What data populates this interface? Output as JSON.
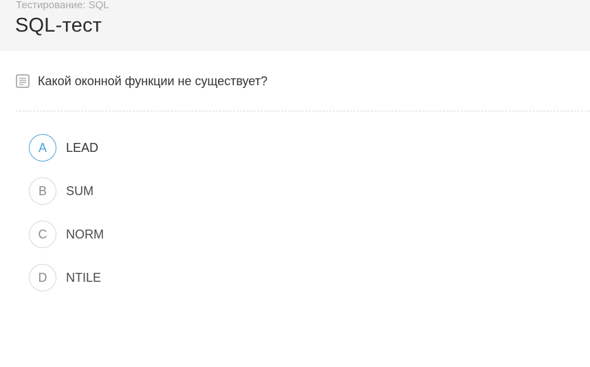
{
  "header": {
    "breadcrumb": "Тестирование: SQL",
    "title": "SQL-тест"
  },
  "question": {
    "icon": "document-icon",
    "text": "Какой оконной функции не существует?"
  },
  "options": [
    {
      "letter": "A",
      "text": "LEAD",
      "highlighted": true
    },
    {
      "letter": "B",
      "text": "SUM",
      "highlighted": false
    },
    {
      "letter": "C",
      "text": "NORM",
      "highlighted": false
    },
    {
      "letter": "D",
      "text": "NTILE",
      "highlighted": false
    }
  ],
  "colors": {
    "accent": "#4aa3d8",
    "header_bg": "#f5f5f5"
  }
}
